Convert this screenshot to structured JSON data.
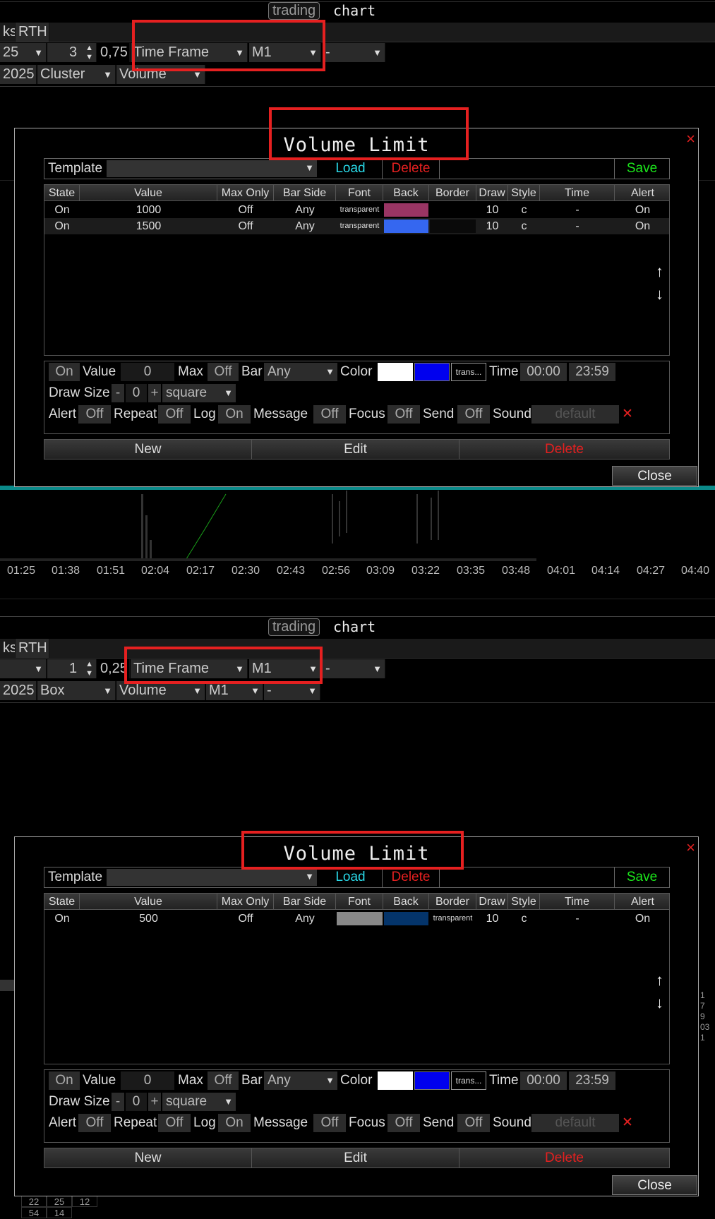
{
  "panels": [
    {
      "header": {
        "title_left": "trading",
        "title_right": "chart",
        "row1": [
          "ks",
          "RTH"
        ],
        "row2": {
          "field_a": "25",
          "field_b": "3",
          "field_c": "0,75",
          "timeframe_type": "Time Frame",
          "timeframe_value": "M1",
          "field_d": "-"
        },
        "row3": {
          "date_tail": "2025",
          "chart_type": "Cluster",
          "data_type": "Volume"
        }
      },
      "time_axis": [
        "01:25",
        "01:38",
        "01:51",
        "02:04",
        "02:17",
        "02:30",
        "02:43",
        "02:56",
        "03:09",
        "03:22",
        "03:35",
        "03:48",
        "04:01",
        "04:14",
        "04:27",
        "04:40"
      ],
      "dialog": {
        "title": "Volume Limit",
        "template_label": "Template",
        "template_value": "",
        "load": "Load",
        "delete": "Delete",
        "save": "Save",
        "columns": [
          "State",
          "Value",
          "Max Only",
          "Bar Side",
          "Font",
          "Back",
          "Border",
          "Draw",
          "Style",
          "Time",
          "Alert"
        ],
        "rows": [
          {
            "state": "On",
            "value": "1000",
            "max_only": "Off",
            "bar_side": "Any",
            "font": "transparent",
            "back": "",
            "border": "",
            "draw": "10",
            "style": "c",
            "time": "-",
            "alert": "On",
            "back_color": "#9a3564",
            "font_color": "",
            "border_color": ""
          },
          {
            "state": "On",
            "value": "1500",
            "max_only": "Off",
            "bar_side": "Any",
            "font": "transparent",
            "back": "",
            "border": "",
            "draw": "10",
            "style": "c",
            "time": "-",
            "alert": "On",
            "back_color": "#3567f0",
            "font_color": "",
            "border_color": ""
          }
        ],
        "editor": {
          "state": "On",
          "value_label": "Value",
          "value": "0",
          "max_label": "Max",
          "max": "Off",
          "bar_label": "Bar",
          "bar": "Any",
          "color_label": "Color",
          "color_trans": "trans...",
          "time_label": "Time",
          "time_from": "00:00",
          "time_to": "23:59",
          "draw_size_label": "Draw Size",
          "minus": "-",
          "size": "0",
          "plus": "+",
          "shape": "square",
          "alert_label": "Alert",
          "alert": "Off",
          "repeat_label": "Repeat",
          "repeat": "Off",
          "log_label": "Log",
          "log": "On",
          "message_label": "Message",
          "message": "Off",
          "focus_label": "Focus",
          "focus": "Off",
          "send_label": "Send",
          "send": "Off",
          "sound_label": "Sound",
          "sound": "default"
        },
        "actions": {
          "new": "New",
          "edit": "Edit",
          "delete": "Delete"
        },
        "close": "Close",
        "close_x": "×"
      }
    },
    {
      "header": {
        "title_left": "trading",
        "title_right": "chart",
        "row1": [
          "ks",
          "RTH"
        ],
        "row2": {
          "field_a": "",
          "field_b": "1",
          "field_c": "0,25",
          "timeframe_type": "Time Frame",
          "timeframe_value": "M1",
          "field_d": "-"
        },
        "row3": {
          "date_tail": "2025",
          "chart_type": "Box",
          "data_type": "Volume",
          "tf2": "M1",
          "field_e": "-"
        }
      },
      "bottom_numbers": [
        "22",
        "25",
        "12",
        "54",
        "14"
      ],
      "side_numbers": [
        "1",
        "7",
        "9",
        "03",
        "1"
      ],
      "dialog": {
        "title": "Volume Limit",
        "template_label": "Template",
        "template_value": "",
        "load": "Load",
        "delete": "Delete",
        "save": "Save",
        "columns": [
          "State",
          "Value",
          "Max Only",
          "Bar Side",
          "Font",
          "Back",
          "Border",
          "Draw",
          "Style",
          "Time",
          "Alert"
        ],
        "rows": [
          {
            "state": "On",
            "value": "500",
            "max_only": "Off",
            "bar_side": "Any",
            "font": "",
            "back": "",
            "border": "transparent",
            "draw": "10",
            "style": "c",
            "time": "-",
            "alert": "On",
            "font_color": "#888888",
            "back_color": "#04346a",
            "border_color": ""
          }
        ],
        "editor": {
          "state": "On",
          "value_label": "Value",
          "value": "0",
          "max_label": "Max",
          "max": "Off",
          "bar_label": "Bar",
          "bar": "Any",
          "color_label": "Color",
          "color_trans": "trans...",
          "time_label": "Time",
          "time_from": "00:00",
          "time_to": "23:59",
          "draw_size_label": "Draw Size",
          "minus": "-",
          "size": "0",
          "plus": "+",
          "shape": "square",
          "alert_label": "Alert",
          "alert": "Off",
          "repeat_label": "Repeat",
          "repeat": "Off",
          "log_label": "Log",
          "log": "On",
          "message_label": "Message",
          "message": "Off",
          "focus_label": "Focus",
          "focus": "Off",
          "send_label": "Send",
          "send": "Off",
          "sound_label": "Sound",
          "sound": "default"
        },
        "actions": {
          "new": "New",
          "edit": "Edit",
          "delete": "Delete"
        },
        "close": "Close",
        "close_x": "×"
      }
    }
  ],
  "colors": {
    "accent_load": "#29d9e8",
    "accent_save": "#1ce81c",
    "danger": "#e52020",
    "highlight": "#e52020",
    "swatch_white": "#ffffff",
    "swatch_blue": "#0000ee"
  }
}
